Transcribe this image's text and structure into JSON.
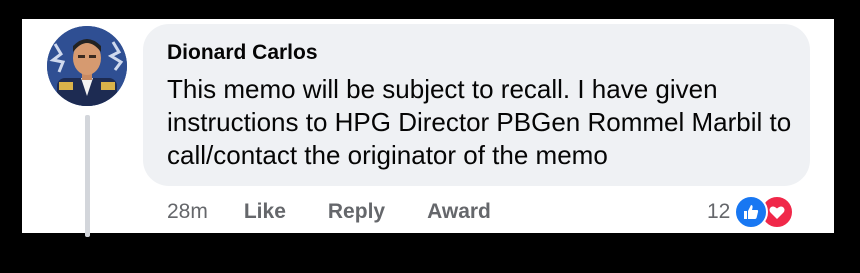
{
  "comment": {
    "author": "Dionard Carlos",
    "body": "This memo will be subject to recall. I have given instructions to HPG Director PBGen Rommel Marbil to call/contact the originator of the memo",
    "avatar_icon": "profile-photo",
    "timestamp": "28m",
    "actions": {
      "like": "Like",
      "reply": "Reply",
      "award": "Award"
    },
    "reactions": {
      "count": "12",
      "types": [
        "like-icon",
        "love-icon"
      ],
      "like_color": "#1877f2",
      "love_color": "#f02849"
    }
  }
}
